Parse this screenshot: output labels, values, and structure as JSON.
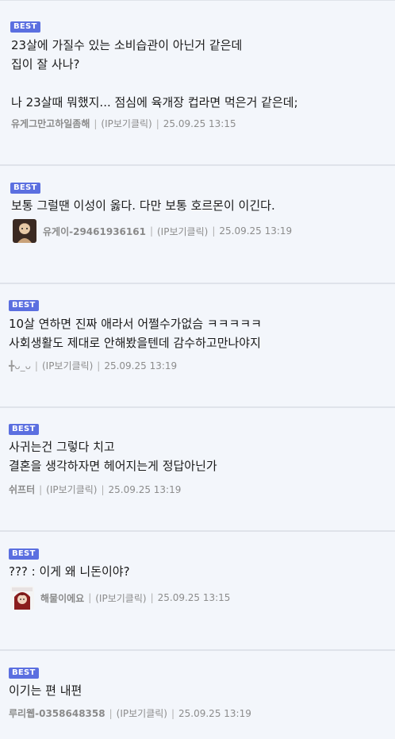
{
  "comments": [
    {
      "badge": "BEST",
      "lines": [
        "23살에 가질수 있는 소비습관이 아닌거 같은데",
        "집이 잘 사나?",
        "",
        "나 23살때 뭐했지... 점심에 육개장 컵라면 먹은거 같은데;"
      ],
      "nick": "유게그만고하일좀해",
      "ip": "(IP보기클릭)",
      "date": "25.09.25 13:15",
      "avatar": null
    },
    {
      "badge": "BEST",
      "lines": [
        "보통 그럴땐 이성이 옳다. 다만 보통 호르몬이 이긴다."
      ],
      "nick": "유게이-29461936161",
      "ip": "(IP보기클릭)",
      "date": "25.09.25 13:19",
      "avatar": "avatar-portrait-icon"
    },
    {
      "badge": "BEST",
      "lines": [
        "10살 연하면 진짜 애라서 어쩔수가없슴 ㅋㅋㅋㅋㅋ",
        "사회생활도 제대로 안해봤을텐데 감수하고만나야지"
      ],
      "nick": "╋ᴗ_ᴗ",
      "ip": "(IP보기클릭)",
      "date": "25.09.25 13:19",
      "avatar": null
    },
    {
      "badge": "BEST",
      "lines": [
        "사귀는건 그렇다 치고",
        "결혼을 생각하자면 헤어지는게 정답아닌가"
      ],
      "nick": "쉬프터",
      "ip": "(IP보기클릭)",
      "date": "25.09.25 13:19",
      "avatar": null
    },
    {
      "badge": "BEST",
      "lines": [
        "??? : 이게 왜 니돈이야?"
      ],
      "nick": "해물이에요",
      "ip": "(IP보기클릭)",
      "date": "25.09.25 13:15",
      "avatar": "avatar-character-icon"
    },
    {
      "badge": "BEST",
      "lines": [
        "이기는 편 내편"
      ],
      "nick": "루리웹-0358648358",
      "ip": "(IP보기클릭)",
      "date": "25.09.25 13:19",
      "avatar": null
    }
  ]
}
